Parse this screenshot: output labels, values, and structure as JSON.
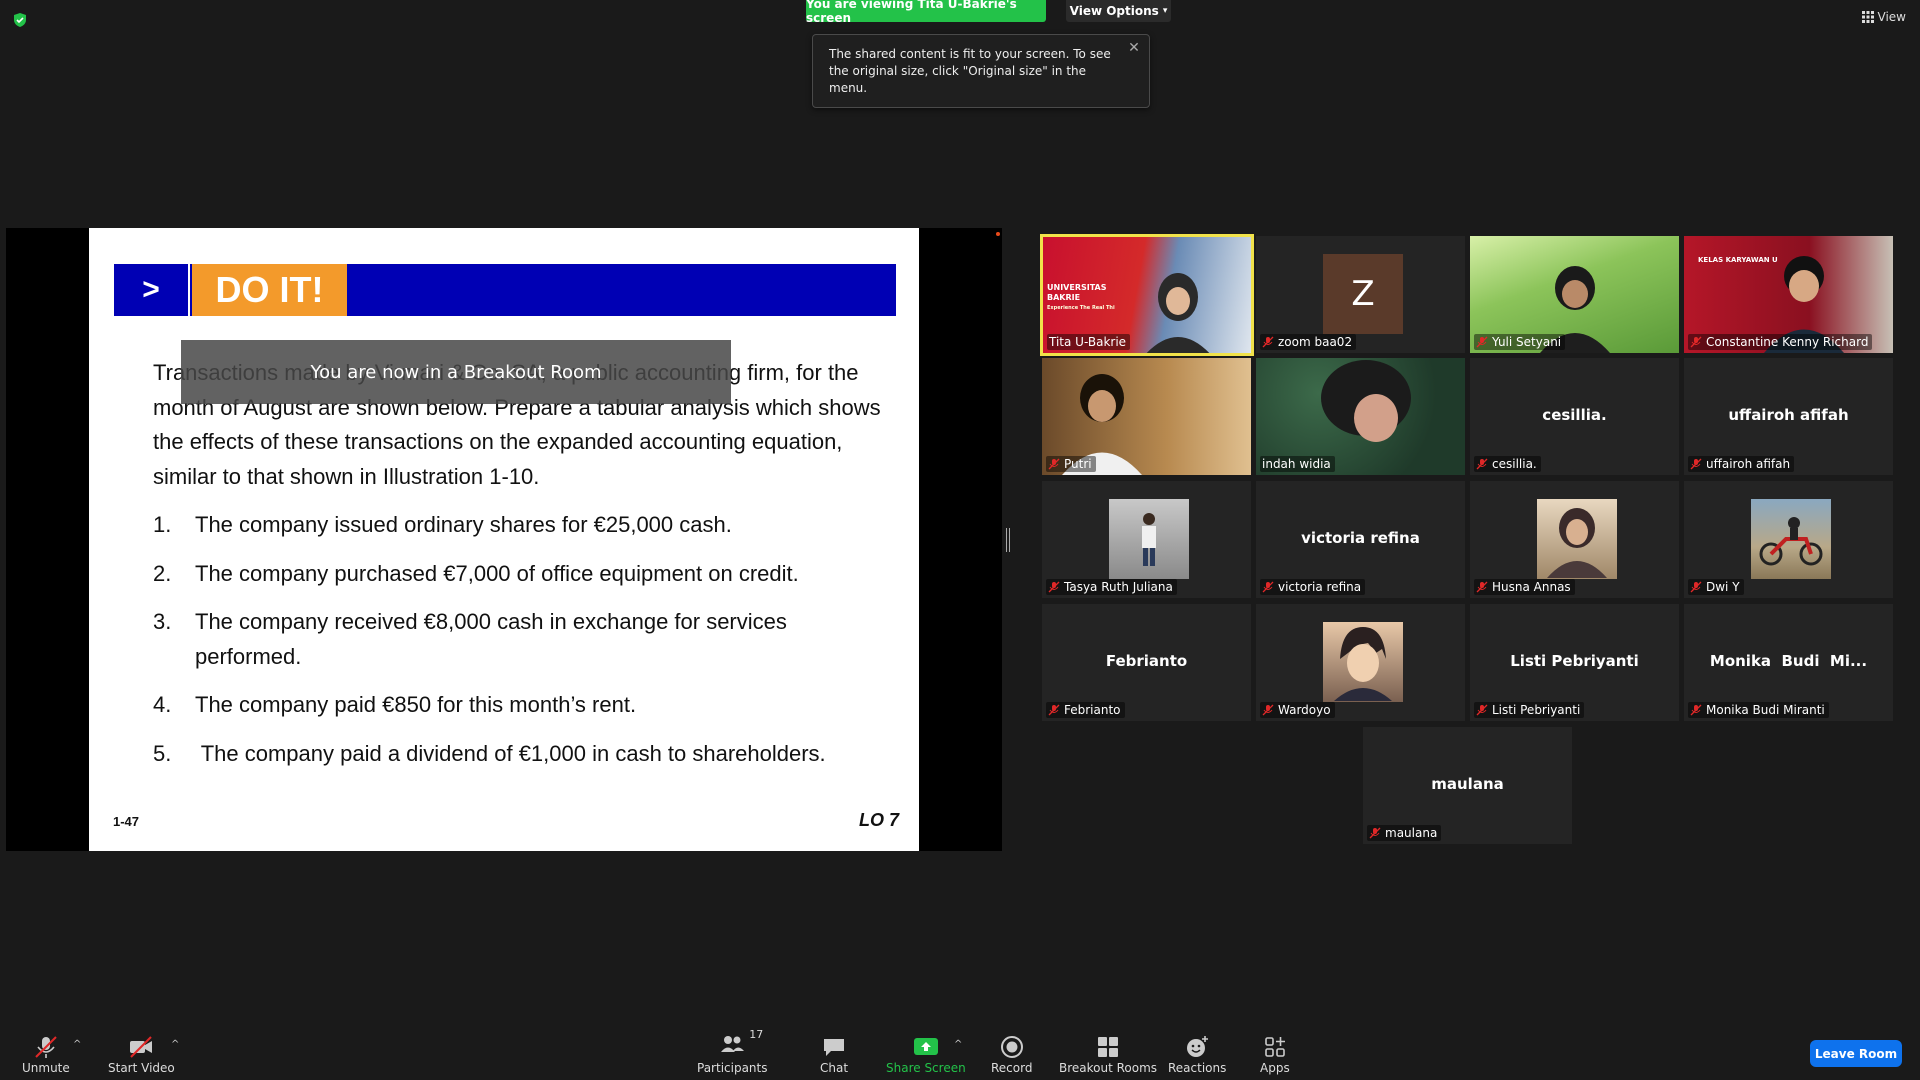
{
  "top": {
    "viewing_text": "You are viewing Tita U-Bakrie's screen",
    "view_options_label": "View Options",
    "view_label": "View"
  },
  "tooltip": {
    "text": "The shared content is fit to your screen. To see the original size, click \"Original size\" in the menu."
  },
  "slide": {
    "banner_arrow": ">",
    "banner_title": "DO IT!",
    "intro": "Transactions made by Virmari & Co. SA, a public accounting firm, for the month of August are shown below. Prepare a tabular analysis which shows the effects of these transactions on the expanded accounting equation, similar to that shown in Illustration 1-10.",
    "items": [
      {
        "num": "1.",
        "text": "The company issued ordinary shares for €25,000 cash."
      },
      {
        "num": "2.",
        "text": "The company purchased €7,000 of office equipment on credit."
      },
      {
        "num": "3.",
        "text": "The company received €8,000 cash in exchange for services performed."
      },
      {
        "num": "4.",
        "text": "The company paid €850 for this month’s rent."
      },
      {
        "num": "5.",
        "text": " The company paid a dividend of €1,000 in cash to shareholders."
      }
    ],
    "footer_left": "1-47",
    "footer_right": "LO 7"
  },
  "breakout_banner": "You are now in a Breakout Room",
  "participants": [
    {
      "name": "Tita U-Bakrie",
      "center": "",
      "muted": false
    },
    {
      "name": "zoom baa02",
      "center": "",
      "avatar_letter": "Z",
      "muted": true
    },
    {
      "name": "Yuli Setyani",
      "center": "",
      "muted": true
    },
    {
      "name": "Constantine Kenny Richard",
      "center": "",
      "muted": true
    },
    {
      "name": "Putri",
      "center": "",
      "muted": true
    },
    {
      "name": "indah widia",
      "center": "",
      "muted": false
    },
    {
      "name": "cesillia.",
      "center": "cesillia.",
      "muted": true
    },
    {
      "name": "uffairoh afifah",
      "center": "uffairoh afifah",
      "muted": true
    },
    {
      "name": "Tasya Ruth Juliana",
      "center": "",
      "muted": true
    },
    {
      "name": "victoria refina",
      "center": "victoria refina",
      "muted": true
    },
    {
      "name": "Husna Annas",
      "center": "",
      "muted": true
    },
    {
      "name": "Dwi Y",
      "center": "",
      "muted": true
    },
    {
      "name": "Febrianto",
      "center": "Febrianto",
      "muted": true
    },
    {
      "name": "Wardoyo",
      "center": "",
      "muted": true
    },
    {
      "name": "Listi Pebriyanti",
      "center": "Listi Pebriyanti",
      "muted": true
    },
    {
      "name": "Monika Budi Miranti",
      "center": "Monika  Budi  Mi...",
      "muted": true
    },
    {
      "name": "maulana",
      "center": "maulana",
      "muted": true
    }
  ],
  "tile_text": {
    "uni_line1": "UNIVERSITAS",
    "uni_line2": "BAKRIE",
    "uni_line3": "Experience The Real Thi",
    "kelas": "KELAS KARYAWAN U"
  },
  "toolbar": {
    "unmute": "Unmute",
    "start_video": "Start Video",
    "participants": "Participants",
    "participants_count": "17",
    "chat": "Chat",
    "share_screen": "Share Screen",
    "record": "Record",
    "breakout_rooms": "Breakout Rooms",
    "reactions": "Reactions",
    "apps": "Apps",
    "leave_room": "Leave Room"
  },
  "colors": {
    "accent_green": "#23c249",
    "leave_blue": "#0e72ed",
    "active_speaker": "#f1e24a",
    "banner_blue": "#0000b4",
    "banner_orange": "#f39a2b"
  }
}
